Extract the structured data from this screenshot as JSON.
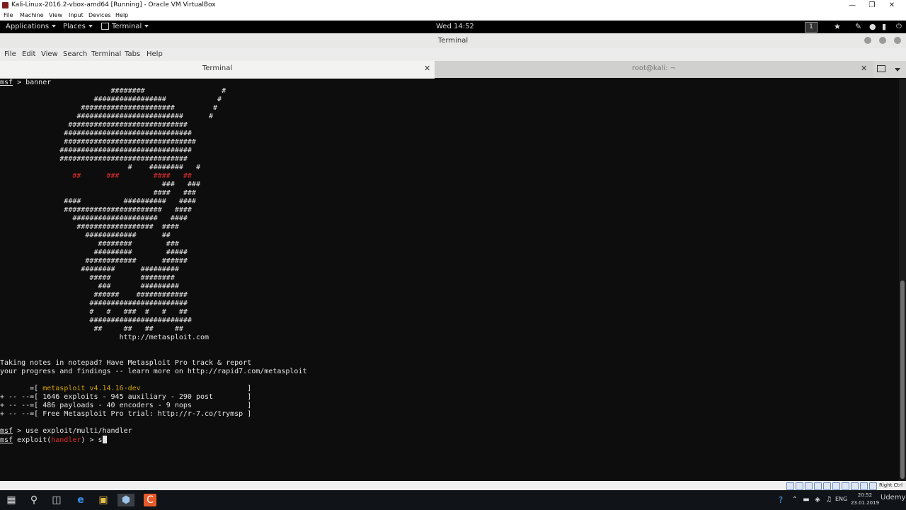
{
  "vbox": {
    "title": "Kali-Linux-2016.2-vbox-amd64 [Running] - Oracle VM VirtualBox",
    "menu": [
      "File",
      "Machine",
      "View",
      "Input",
      "Devices",
      "Help"
    ],
    "host_key": "Right Ctrl"
  },
  "gnome": {
    "applications": "Applications",
    "places": "Places",
    "terminal": "Terminal",
    "clock": "Wed 14:52",
    "workspace": "1"
  },
  "terminal": {
    "title": "Terminal",
    "menu": [
      "File",
      "Edit",
      "View",
      "Search",
      "Terminal",
      "Tabs",
      "Help"
    ],
    "tabs": [
      {
        "label": "Terminal"
      },
      {
        "label": "root@kali: ~"
      }
    ]
  },
  "console": {
    "prompt": "msf",
    "cmd_banner": " > banner",
    "art": [
      "                          ########                  #",
      "                      #################            #",
      "                   ######################         #",
      "                  #########################      #",
      "                ############################",
      "               ##############################",
      "               ###############################",
      "              ###############################",
      "              ##############################",
      "                              #    ########   #",
      "                 ##      ###        ####   ##",
      "                                      ###   ###",
      "                                    ####   ###",
      "               ####          ##########   ####",
      "               #######################   ####",
      "                 ####################   ####",
      "                  ##################  ####",
      "                    ############      ##",
      "                       ########        ###",
      "                      #########        #####",
      "                    ############      ######",
      "                   ########      #########",
      "                     #####       ########",
      "                       ###       #########",
      "                      ######    ############",
      "                     #######################",
      "                     #   #   ###  #   #   ##",
      "                     ########################",
      "                      ##     ##   ##     ##"
    ],
    "url": "                            http://metasploit.com",
    "tip1": "Taking notes in notepad? Have Metasploit Pro track & report",
    "tip2": "your progress and findings -- learn more on http://rapid7.com/metasploit",
    "ver_prefix": "       =[ ",
    "version": "metasploit v4.14.16-dev",
    "ver_suffix": "                         ]",
    "stats1": "+ -- --=[ 1646 exploits - 945 auxiliary - 290 post        ]",
    "stats2": "+ -- --=[ 486 payloads - 40 encoders - 9 nops             ]",
    "stats3": "+ -- --=[ Free Metasploit Pro trial: http://r-7.co/trymsp ]",
    "cmd_use": " > use exploit/multi/handler",
    "exploit_prefix": " exploit(",
    "module": "handler",
    "exploit_suffix": ") > ",
    "typed": "s"
  },
  "taskbar": {
    "lang": "ENG",
    "time": "20:52",
    "date": "23.01.2019"
  },
  "watermark": "Udemy"
}
